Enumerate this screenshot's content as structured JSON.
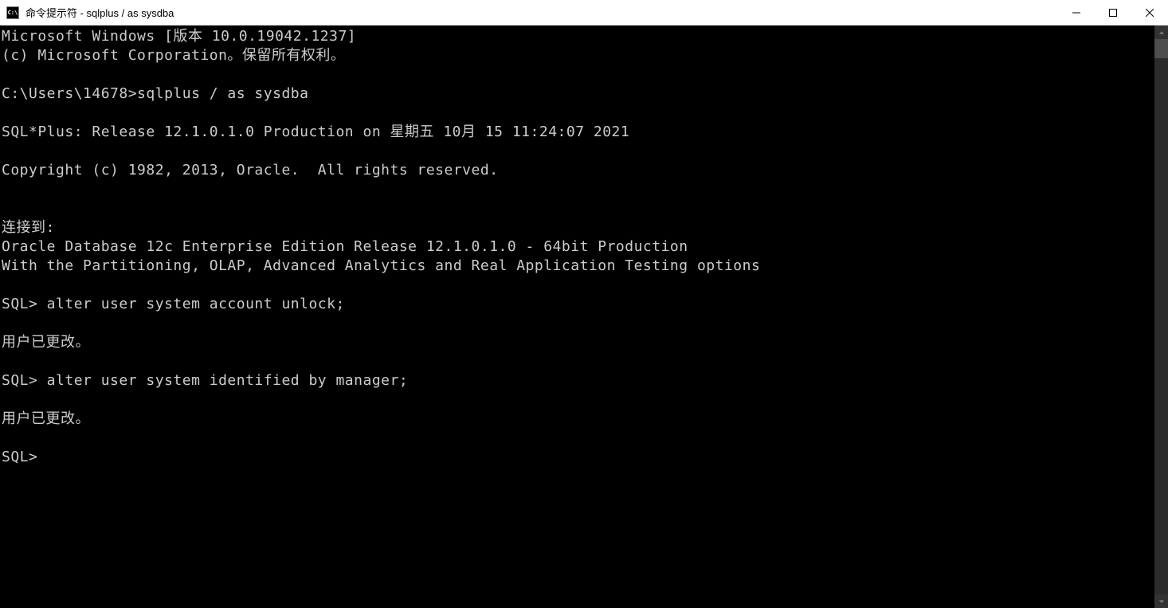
{
  "window": {
    "title": "命令提示符 - sqlplus  / as sysdba",
    "icon_label": "C:\\"
  },
  "terminal": {
    "lines": [
      "Microsoft Windows [版本 10.0.19042.1237]",
      "(c) Microsoft Corporation。保留所有权利。",
      "",
      "C:\\Users\\14678>sqlplus / as sysdba",
      "",
      "SQL*Plus: Release 12.1.0.1.0 Production on 星期五 10月 15 11:24:07 2021",
      "",
      "Copyright (c) 1982, 2013, Oracle.  All rights reserved.",
      "",
      "",
      "连接到:",
      "Oracle Database 12c Enterprise Edition Release 12.1.0.1.0 - 64bit Production",
      "With the Partitioning, OLAP, Advanced Analytics and Real Application Testing options",
      "",
      "SQL> alter user system account unlock;",
      "",
      "用户已更改。",
      "",
      "SQL> alter user system identified by manager;",
      "",
      "用户已更改。",
      "",
      "SQL>"
    ]
  }
}
